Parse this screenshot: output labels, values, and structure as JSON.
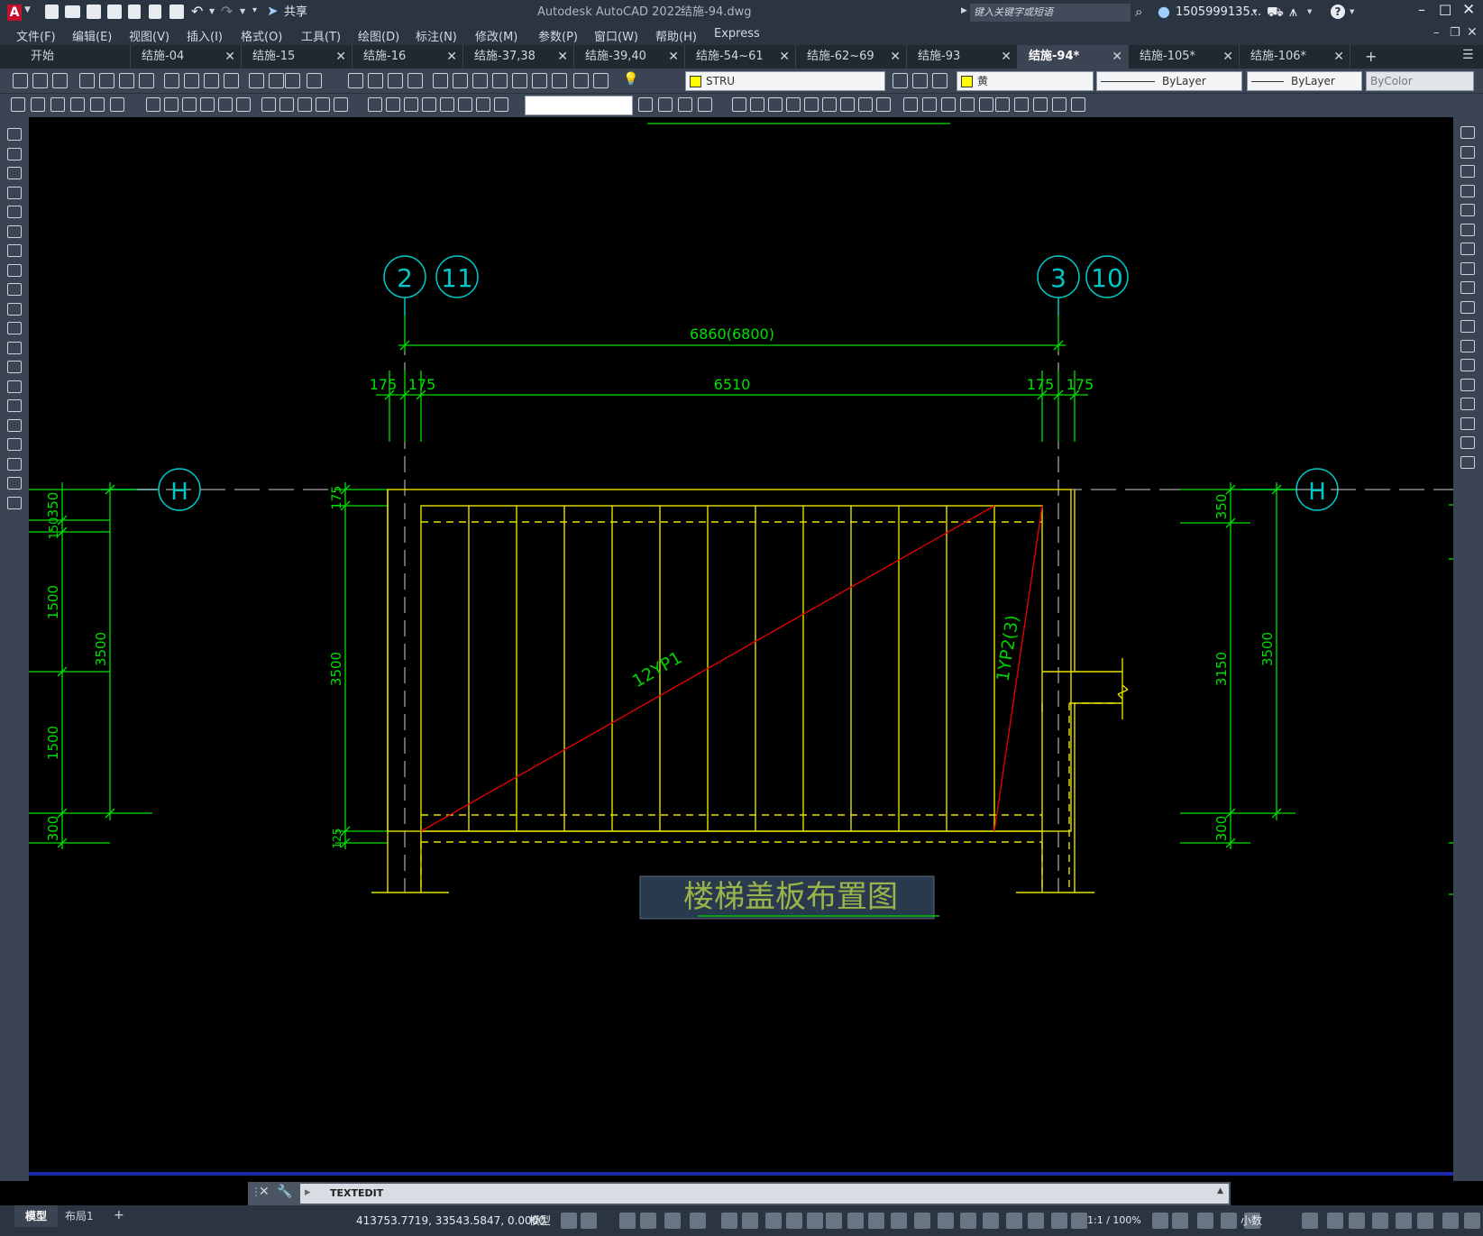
{
  "title_bar": {
    "app_title": "Autodesk AutoCAD 2022",
    "file_name": "结施-94.dwg",
    "share_label": "共享",
    "search_placeholder": "键入关键字或短语",
    "user_name": "1505999135...",
    "help_label": "?"
  },
  "menu": [
    "文件(F)",
    "编辑(E)",
    "视图(V)",
    "插入(I)",
    "格式(O)",
    "工具(T)",
    "绘图(D)",
    "标注(N)",
    "修改(M)",
    "参数(P)",
    "窗口(W)",
    "帮助(H)",
    "Express"
  ],
  "tabs": [
    {
      "label": "开始"
    },
    {
      "label": "结施-04"
    },
    {
      "label": "结施-15"
    },
    {
      "label": "结施-16"
    },
    {
      "label": "结施-37,38"
    },
    {
      "label": "结施-39,40"
    },
    {
      "label": "结施-54~61"
    },
    {
      "label": "结施-62~69"
    },
    {
      "label": "结施-93"
    },
    {
      "label": "结施-94*",
      "active": true
    },
    {
      "label": "结施-105*"
    },
    {
      "label": "结施-106*"
    }
  ],
  "properties": {
    "layer": "STRU",
    "color": "黄",
    "linetype": "ByLayer",
    "lineweight": "ByLayer",
    "plotstyle": "ByColor",
    "layer_color_hex": "#ffff00"
  },
  "drawing": {
    "axis_labels": {
      "a2": "2",
      "a11": "11",
      "a3": "3",
      "a10": "10",
      "h_left": "H",
      "h_right": "H"
    },
    "dims_top": {
      "overall": "6860(6800)",
      "left_a": "175",
      "left_b": "175",
      "mid": "6510",
      "right_a": "175",
      "right_b": "175"
    },
    "dims_left_far": {
      "d350": "350",
      "d150": "150",
      "d1500a": "1500",
      "d1500b": "1500",
      "d300": "300",
      "d3500": "3500"
    },
    "dims_left_near": {
      "d175": "175",
      "d3500": "3500",
      "d125": "125"
    },
    "dims_right": {
      "d350": "350",
      "d3150": "3150",
      "d300": "300",
      "d3500": "3500"
    },
    "labels": {
      "slab1": "12YP1",
      "slab2": "1YP2(3)"
    },
    "title": "楼梯盖板布置图",
    "colors": {
      "dim": "#00ff00",
      "axis": "#00d0d0",
      "structure": "#e8e000",
      "diagonal": "#e00000",
      "title": "#9ab54a"
    }
  },
  "command_line": {
    "text": "TEXTEDIT"
  },
  "status": {
    "model_tab": "模型",
    "layout_tab": "布局1",
    "add_tab": "+",
    "coords": "413753.7719, 33543.5847, 0.0000",
    "model_label": "模型",
    "scale": "1:1 / 100%",
    "units": "小数"
  }
}
